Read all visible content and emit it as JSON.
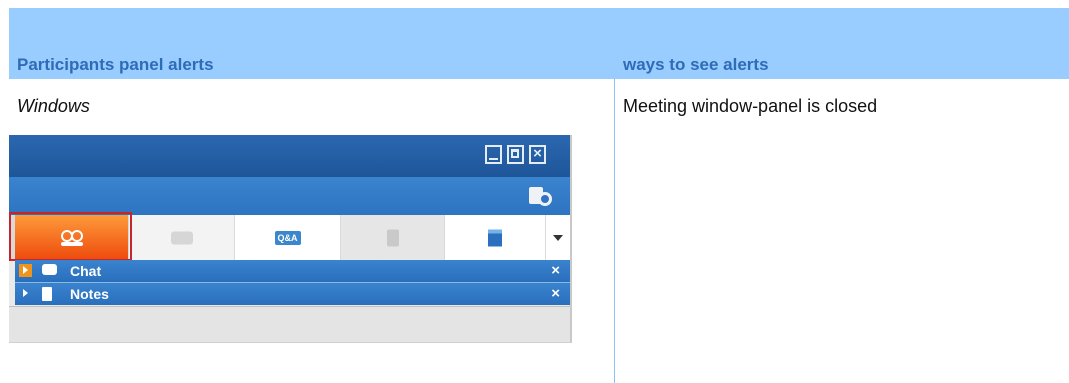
{
  "table": {
    "headers": [
      "Participants panel alerts",
      "ways to see alerts"
    ],
    "rows": [
      {
        "left": "Windows",
        "right": "Meeting window-panel is closed"
      }
    ]
  },
  "screenshot": {
    "tabs": [
      {
        "name": "participants",
        "icon": "people-icon",
        "selected": true
      },
      {
        "name": "chat",
        "icon": "chat-bubble-icon"
      },
      {
        "name": "qa",
        "icon": "qa-icon",
        "text": "Q&A"
      },
      {
        "name": "notes",
        "icon": "notes-icon"
      },
      {
        "name": "poll",
        "icon": "poll-icon"
      },
      {
        "name": "more",
        "icon": "chevron-down-icon"
      }
    ],
    "panels": [
      {
        "label": "Chat",
        "close": "×"
      },
      {
        "label": "Notes",
        "close": "×"
      }
    ],
    "window_buttons": {
      "close": "×"
    },
    "colors": {
      "header_band": "#99ccff",
      "header_text": "#2f6bb7",
      "selected_tab": "#ff7a22",
      "highlight_border": "#c4262e",
      "panel_bar": "#2e74c0"
    }
  }
}
